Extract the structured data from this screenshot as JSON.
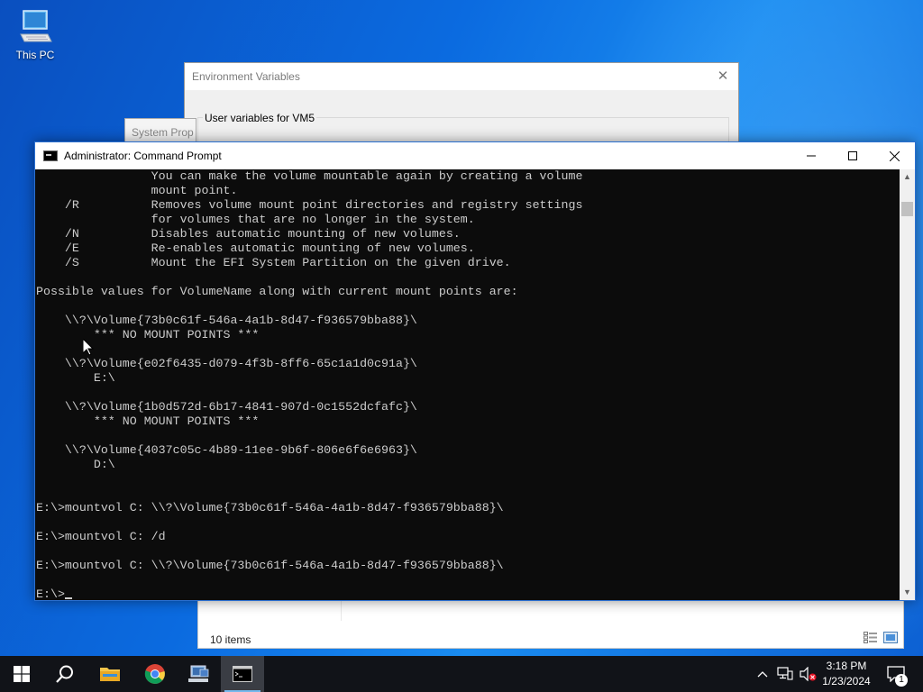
{
  "desktop": {
    "icons": [
      {
        "label": "This PC",
        "icon": "this-pc-icon"
      }
    ]
  },
  "env_window": {
    "title": "Environment Variables",
    "group_label": "User variables for VM5"
  },
  "sys_window": {
    "title": "System Prop"
  },
  "explorer": {
    "status": "10 items"
  },
  "cmd": {
    "title": "Administrator: Command Prompt",
    "lines": [
      "                You can make the volume mountable again by creating a volume",
      "                mount point.",
      "    /R          Removes volume mount point directories and registry settings",
      "                for volumes that are no longer in the system.",
      "    /N          Disables automatic mounting of new volumes.",
      "    /E          Re-enables automatic mounting of new volumes.",
      "    /S          Mount the EFI System Partition on the given drive.",
      "",
      "Possible values for VolumeName along with current mount points are:",
      "",
      "    \\\\?\\Volume{73b0c61f-546a-4a1b-8d47-f936579bba88}\\",
      "        *** NO MOUNT POINTS ***",
      "",
      "    \\\\?\\Volume{e02f6435-d079-4f3b-8ff6-65c1a1d0c91a}\\",
      "        E:\\",
      "",
      "    \\\\?\\Volume{1b0d572d-6b17-4841-907d-0c1552dcfafc}\\",
      "        *** NO MOUNT POINTS ***",
      "",
      "    \\\\?\\Volume{4037c05c-4b89-11ee-9b6f-806e6f6e6963}\\",
      "        D:\\",
      "",
      "",
      "E:\\>mountvol C: \\\\?\\Volume{73b0c61f-546a-4a1b-8d47-f936579bba88}\\",
      "",
      "E:\\>mountvol C: /d",
      "",
      "E:\\>mountvol C: \\\\?\\Volume{73b0c61f-546a-4a1b-8d47-f936579bba88}\\",
      ""
    ],
    "prompt": "E:\\>"
  },
  "taskbar": {
    "apps": [
      {
        "name": "start",
        "icon": "windows-logo-icon"
      },
      {
        "name": "search",
        "icon": "search-icon"
      },
      {
        "name": "file-explorer",
        "icon": "folder-icon"
      },
      {
        "name": "chrome",
        "icon": "chrome-icon"
      },
      {
        "name": "network-app",
        "icon": "computer-network-icon"
      },
      {
        "name": "command-prompt",
        "icon": "terminal-icon"
      }
    ],
    "clock": {
      "time": "3:18 PM",
      "date": "1/23/2024"
    },
    "notification_count": "1"
  }
}
